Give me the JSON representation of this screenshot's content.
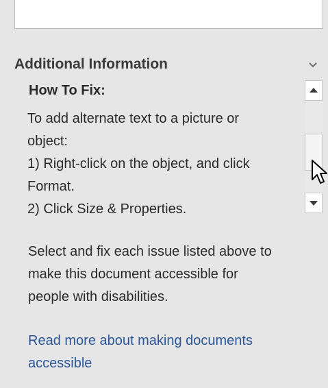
{
  "section": {
    "title": "Additional Information",
    "chevron_icon": "chevron-down-icon"
  },
  "how_to_fix": {
    "heading": "How To Fix:",
    "lines": [
      "To add alternate text to a picture or",
      "object:",
      "1) Right-click on the object, and click",
      "Format.",
      "2) Click Size & Properties."
    ]
  },
  "scrollbar": {
    "up_icon": "scroll-up-arrow-icon",
    "down_icon": "scroll-down-arrow-icon"
  },
  "summary": {
    "lines": [
      "Select and fix each issue listed above to",
      "make this document accessible for",
      "people with disabilities."
    ]
  },
  "read_more": {
    "lines": [
      "Read more about making documents",
      "accessible"
    ]
  },
  "colors": {
    "panel_background": "#e6e6e6",
    "link": "#2b579a",
    "text": "#2a2a2a"
  }
}
